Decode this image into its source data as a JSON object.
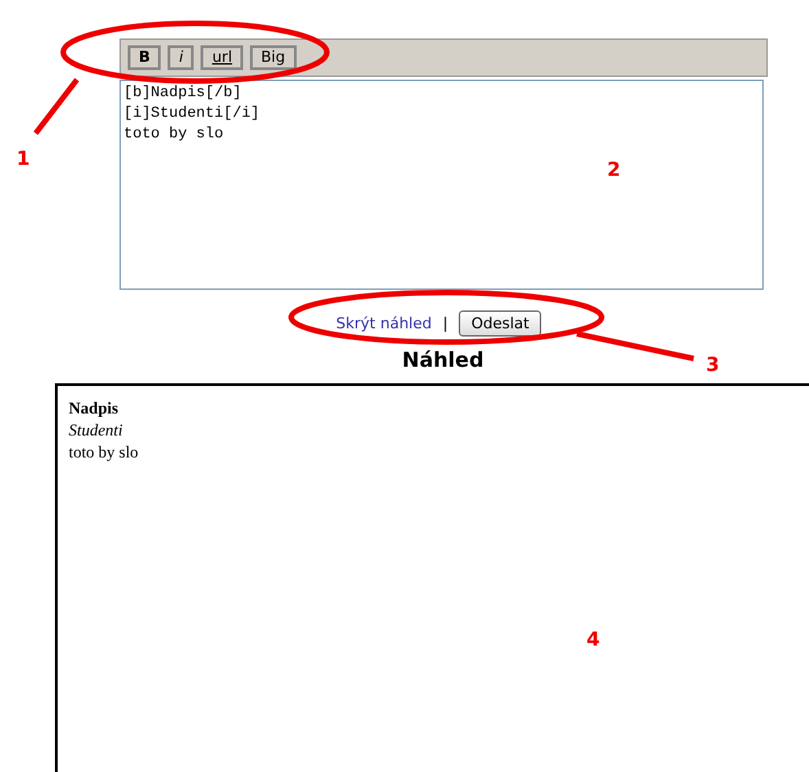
{
  "toolbar": {
    "buttons": [
      {
        "label": "B",
        "kind": "bold"
      },
      {
        "label": "i",
        "kind": "italic"
      },
      {
        "label": "url",
        "kind": "underline"
      },
      {
        "label": "Big",
        "kind": "plain"
      }
    ]
  },
  "editor": {
    "value": [
      "[b]Nadpis[/b]",
      "[i]Studenti[/i]",
      "toto by slo"
    ]
  },
  "actions": {
    "link": "Skrýt náhled",
    "separator": "|",
    "button": "Odeslat"
  },
  "preview": {
    "title": "Náhled",
    "lines": [
      {
        "text": "Nadpis",
        "kind": "bold"
      },
      {
        "text": "Studenti",
        "kind": "italic"
      },
      {
        "text": "toto by slo",
        "kind": "plain"
      }
    ]
  },
  "annotations": [
    {
      "number": "1"
    },
    {
      "number": "2"
    },
    {
      "number": "3"
    },
    {
      "number": "4"
    }
  ]
}
